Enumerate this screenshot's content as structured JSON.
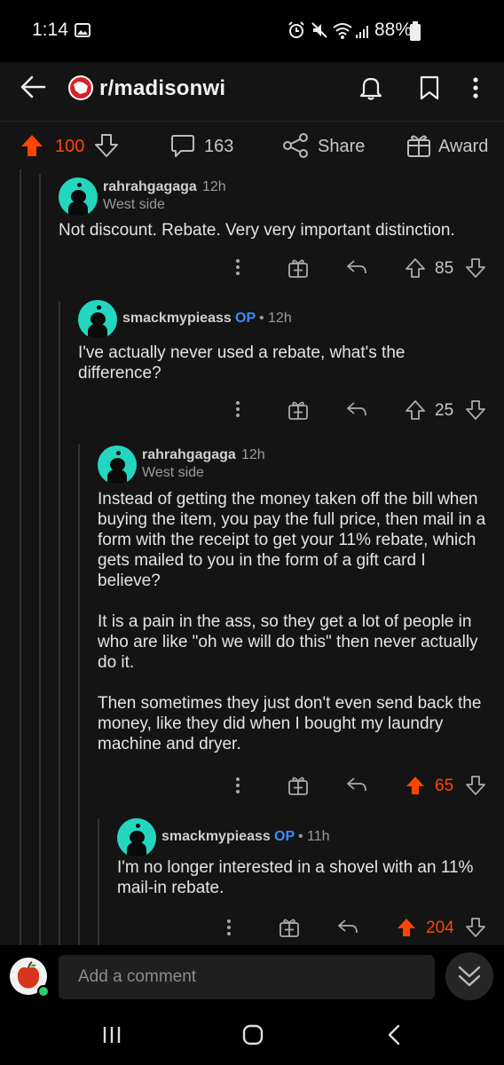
{
  "status": {
    "time": "1:14",
    "battery": "88%"
  },
  "header": {
    "subreddit": "r/madisonwi"
  },
  "post_actions": {
    "score": "100",
    "comments": "163",
    "share": "Share",
    "award": "Award"
  },
  "comments": [
    {
      "user": "rahrahgagaga",
      "op": "",
      "age": "12h",
      "flair": "West side",
      "paragraphs": [
        "Not discount. Rebate. Very very important distinction."
      ],
      "score": "85"
    },
    {
      "user": "smackmypieass",
      "op": "OP",
      "age": "• 12h",
      "flair": "",
      "paragraphs": [
        "I've actually never used a rebate, what's the difference?"
      ],
      "score": "25"
    },
    {
      "user": "rahrahgagaga",
      "op": "",
      "age": "12h",
      "flair": "West side",
      "paragraphs": [
        "Instead of getting the money taken off the bill when buying the item, you pay the full price, then mail in a form with the receipt to get your 11% rebate, which gets mailed to you in the form of a gift card I believe?",
        "It is a pain in the ass, so they get a lot of people in who are like \"oh we will do this\" then never actually do it.",
        "Then sometimes they just don't even send back the money, like they did when I bought my laundry machine and dryer."
      ],
      "score": "65"
    },
    {
      "user": "smackmypieass",
      "op": "OP",
      "age": "• 11h",
      "flair": "",
      "paragraphs": [
        "I'm no longer interested in a shovel with an 11% mail-in rebate."
      ],
      "score": "204"
    }
  ],
  "composer": {
    "placeholder": "Add a comment"
  },
  "colors": {
    "upvote": "#ff4500",
    "op": "#3b8bff",
    "avatar": "#24d6c0"
  },
  "icons": [
    "back-arrow-icon",
    "subreddit-icon",
    "bell-icon",
    "bookmark-icon",
    "more-icon",
    "upvote-icon",
    "downvote-icon",
    "comment-icon",
    "share-icon",
    "award-icon",
    "reply-icon",
    "recents-icon",
    "home-icon",
    "back-nav-icon"
  ]
}
